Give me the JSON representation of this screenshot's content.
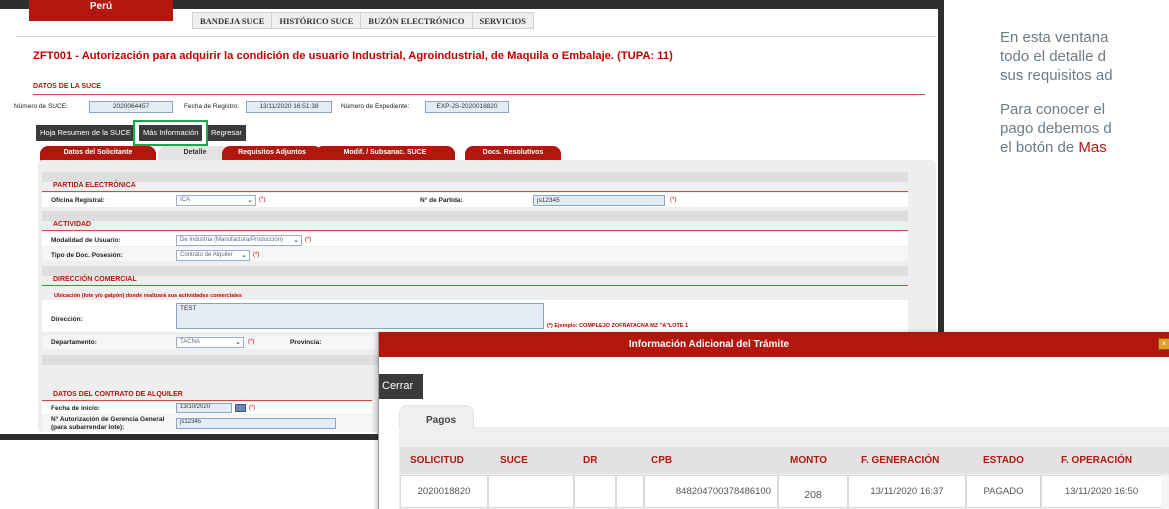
{
  "nav": {
    "brand": "Perú",
    "items": [
      "BANDEJA SUCE",
      "HISTÓRICO SUCE",
      "BUZÓN ELECTRÓNICO",
      "SERVICIOS"
    ]
  },
  "page_title": "ZFT001 - Autorización para adquirir la condición de usuario Industrial, Agroindustrial, de Maquila o Embalaje. (TUPA: 11)",
  "suce": {
    "section_title": "DATOS DE LA SUCE",
    "numero_label": "Número de SUCE:",
    "numero_value": "2020064457",
    "fecha_label": "Fecha de Registro:",
    "fecha_value": "13/11/2020 16:51:38",
    "expediente_label": "Número de Expediente:",
    "expediente_value": "EXP-JS-2020018820"
  },
  "actions": {
    "resumen": "Hoja Resumen de la SUCE",
    "mas_info": "Más Información",
    "regresar": "Regresar"
  },
  "tabs": [
    "Datos del Solicitante",
    "Detalle",
    "Requisitos Adjuntos",
    "Modif. / Subsanac. SUCE",
    "Docs. Resolutivos"
  ],
  "detail": {
    "partida_title": "PARTIDA ELECTRÓNICA",
    "oficina_label": "Oficina Registral:",
    "oficina_value": "ICA",
    "partida_label": "N° de Partida:",
    "partida_value": "js12345",
    "actividad_title": "ACTIVIDAD",
    "modalidad_label": "Modalidad de Usuario:",
    "modalidad_value": "De Industria (Manufactura/Producción)",
    "tipo_doc_label": "Tipo de Doc. Posesión:",
    "tipo_doc_value": "Contrato de Alquiler",
    "direccion_title": "DIRECCIÓN COMERCIAL",
    "ubicacion_note": "Ubicación (lote y/o galpón) donde realizará sus actividades comerciales",
    "direccion_label": "Dirección:",
    "direccion_value": "TEST",
    "direccion_example": "(*) Ejemplo: COMPLEJO ZOFRATACNA MZ \"A\"LOTE 1",
    "departamento_label": "Departamento:",
    "departamento_value": "TACNA",
    "provincia_label": "Provincia:",
    "contrato_title": "DATOS DEL CONTRATO DE ALQUILER",
    "fecha_inicio_label": "Fecha de inicio:",
    "fecha_inicio_value": "13/10/2020",
    "autorizacion_label_1": "N° Autorización de Gerencia General",
    "autorizacion_label_2": "(para subarrendar lote):",
    "autorizacion_value": "js12345",
    "required_mark": "(*)"
  },
  "explain": {
    "line1": "En esta ventana",
    "line2": "todo el detalle d",
    "line3": "sus requisitos ad",
    "line4": "Para conocer el",
    "line5": "pago debemos d",
    "line6_prefix": "el botón de ",
    "line6_highlight": "Mas"
  },
  "popup": {
    "title": "Información Adicional del Trámite",
    "close_label": "Cerrar",
    "tab_label": "Pagos",
    "columns": [
      "SOLICITUD",
      "SUCE",
      "DR",
      "CPB",
      "MONTO",
      "F. GENERACIÓN",
      "ESTADO",
      "F. OPERACIÓN"
    ],
    "row": {
      "solicitud": "2020018820",
      "suce": "",
      "dr": "",
      "cpb": "848204700378486100",
      "monto": "208",
      "f_generacion": "13/11/2020 16:37",
      "estado": "PAGADO",
      "f_operacion": "13/11/2020 16:50"
    }
  }
}
